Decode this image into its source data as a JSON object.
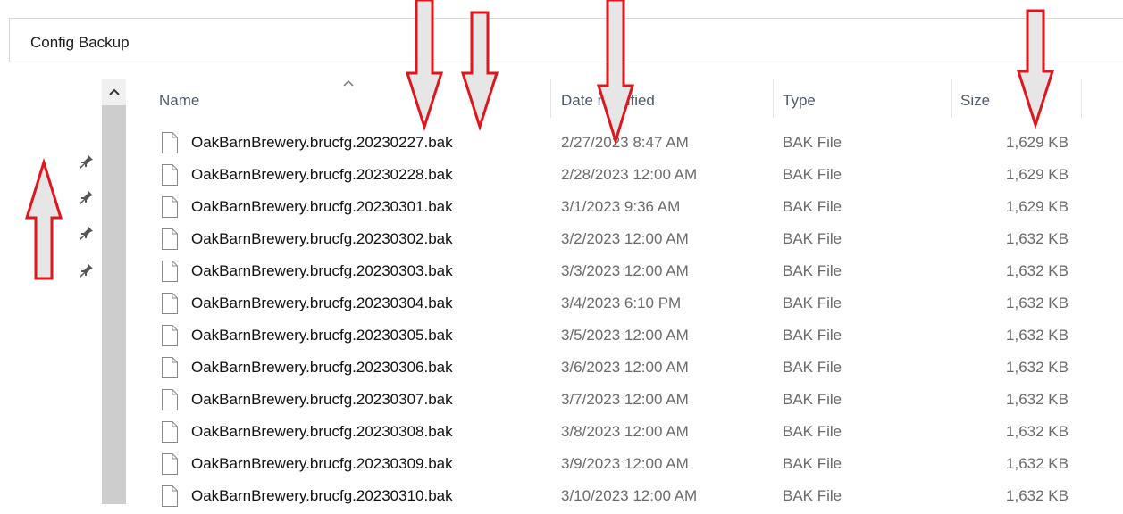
{
  "address": {
    "path": "Config Backup"
  },
  "columns": {
    "name": "Name",
    "date": "Date modified",
    "type": "Type",
    "size": "Size"
  },
  "icons": {
    "scroll_up": "chevron-up-icon",
    "sort": "sort-ascending-icon",
    "pin": "pin-icon",
    "file": "file-icon"
  },
  "files": [
    {
      "name": "OakBarnBrewery.brucfg.20230227.bak",
      "date": "2/27/2023 8:47 AM",
      "type": "BAK File",
      "size": "1,629 KB"
    },
    {
      "name": "OakBarnBrewery.brucfg.20230228.bak",
      "date": "2/28/2023 12:00 AM",
      "type": "BAK File",
      "size": "1,629 KB"
    },
    {
      "name": "OakBarnBrewery.brucfg.20230301.bak",
      "date": "3/1/2023 9:36 AM",
      "type": "BAK File",
      "size": "1,629 KB"
    },
    {
      "name": "OakBarnBrewery.brucfg.20230302.bak",
      "date": "3/2/2023 12:00 AM",
      "type": "BAK File",
      "size": "1,632 KB"
    },
    {
      "name": "OakBarnBrewery.brucfg.20230303.bak",
      "date": "3/3/2023 12:00 AM",
      "type": "BAK File",
      "size": "1,632 KB"
    },
    {
      "name": "OakBarnBrewery.brucfg.20230304.bak",
      "date": "3/4/2023 6:10 PM",
      "type": "BAK File",
      "size": "1,632 KB"
    },
    {
      "name": "OakBarnBrewery.brucfg.20230305.bak",
      "date": "3/5/2023 12:00 AM",
      "type": "BAK File",
      "size": "1,632 KB"
    },
    {
      "name": "OakBarnBrewery.brucfg.20230306.bak",
      "date": "3/6/2023 12:00 AM",
      "type": "BAK File",
      "size": "1,632 KB"
    },
    {
      "name": "OakBarnBrewery.brucfg.20230307.bak",
      "date": "3/7/2023 12:00 AM",
      "type": "BAK File",
      "size": "1,632 KB"
    },
    {
      "name": "OakBarnBrewery.brucfg.20230308.bak",
      "date": "3/8/2023 12:00 AM",
      "type": "BAK File",
      "size": "1,632 KB"
    },
    {
      "name": "OakBarnBrewery.brucfg.20230309.bak",
      "date": "3/9/2023 12:00 AM",
      "type": "BAK File",
      "size": "1,632 KB"
    },
    {
      "name": "OakBarnBrewery.brucfg.20230310.bak",
      "date": "3/10/2023 12:00 AM",
      "type": "BAK File",
      "size": "1,632 KB"
    }
  ],
  "annotation_color": "#e0161c"
}
